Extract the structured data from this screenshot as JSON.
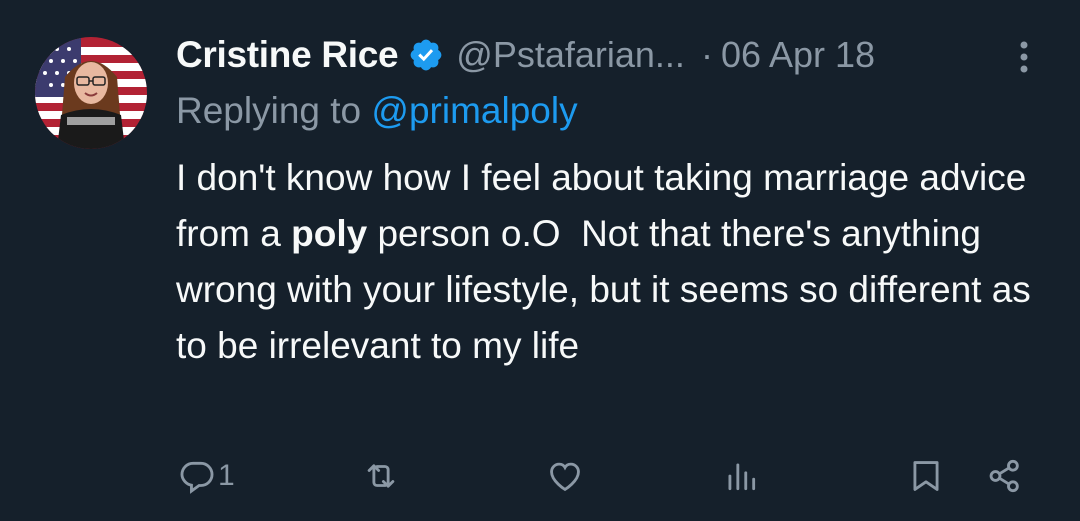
{
  "tweet": {
    "author_name": "Cristine Rice",
    "handle": "@Pstafarian...",
    "separator": "·",
    "date": "06 Apr 18",
    "replying_prefix": "Replying to",
    "replying_mention": "@primalpoly",
    "body_before_bold": "I don't know how I feel about taking marriage advice from a ",
    "body_bold": "poly",
    "body_after_bold": " person o.O  Not that there's anything wrong with your lifestyle, but it seems so different as to be irrelevant to my life"
  },
  "actions": {
    "reply_count": "1"
  },
  "icons": {
    "verified": "verified-badge-icon",
    "more": "more-vertical-icon",
    "reply": "reply-icon",
    "retweet": "retweet-icon",
    "like": "heart-icon",
    "views": "views-bar-chart-icon",
    "bookmark": "bookmark-icon",
    "share": "share-icon"
  },
  "colors": {
    "background": "#15202b",
    "text": "#f7f9f9",
    "secondary": "#8b98a5",
    "accent": "#1d9bf0"
  }
}
